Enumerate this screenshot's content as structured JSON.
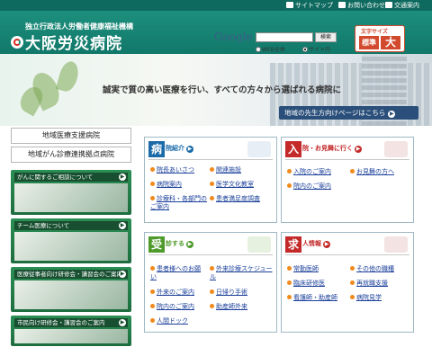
{
  "utility": {
    "sitemap": "サイトマップ",
    "contact": "お問い合わせ",
    "access": "交通案内"
  },
  "header": {
    "org": "独立行政法人労働者健康福祉機構",
    "hospital": "大阪労災病院"
  },
  "search": {
    "brand": "Google",
    "button": "検索",
    "opt_web": "WEB全体",
    "opt_site": "サイト内",
    "selected": "サイト内"
  },
  "fontsize": {
    "label": "文字サイズ",
    "standard": "標準",
    "large": "大"
  },
  "hero": {
    "tagline": "誠実で質の高い医療を行い、すべての方々から選ばれる病院に",
    "doctor_link": "地域の先生方向けページはこちら"
  },
  "left": {
    "item1": "地域医療支援病院",
    "item2": "地域がん診療連携拠点病院",
    "btn1": "がんに関するご相談について",
    "btn2": "チーム医療について",
    "btn3": "医療従事者向け研修会・講習会のご案内",
    "btn4": "市民向け研修会・講習会のご案内"
  },
  "hospital_info": {
    "kanji": "病",
    "title": "院紹介",
    "links": [
      "院長あいさつ",
      "関連施設",
      "病院案内",
      "医学文化教室",
      "診療科・各部門のご案内",
      "患者満足度調査"
    ]
  },
  "visit": {
    "kanji": "入",
    "title": "院・お見舞に行く",
    "links": [
      "入院のご案内",
      "お見舞の方へ",
      "院内のご案内"
    ]
  },
  "outpatient": {
    "kanji": "受",
    "title": "診する",
    "links": [
      "患者様へのお願い",
      "外来診療スケジュール",
      "外来のご案内",
      "日帰り手術",
      "院内のご案内",
      "助産師外来",
      "人間ドック"
    ]
  },
  "recruit": {
    "kanji": "求",
    "title": "人情報",
    "links": [
      "常勤医師",
      "その他の職種",
      "臨床研修医",
      "再就職支援",
      "看護師・助産師",
      "病院見学"
    ]
  },
  "colors": {
    "header": "#11786a",
    "hospital_box": "#1b6ba8",
    "visit_box": "#c42a2a",
    "outpatient_box": "#4e9a2a",
    "recruit_box": "#c42a2a",
    "bullet": "#f08a1d"
  },
  "icons": [
    "sitemap-icon",
    "mail-icon",
    "train-icon",
    "logo-icon",
    "arrow-icon"
  ]
}
